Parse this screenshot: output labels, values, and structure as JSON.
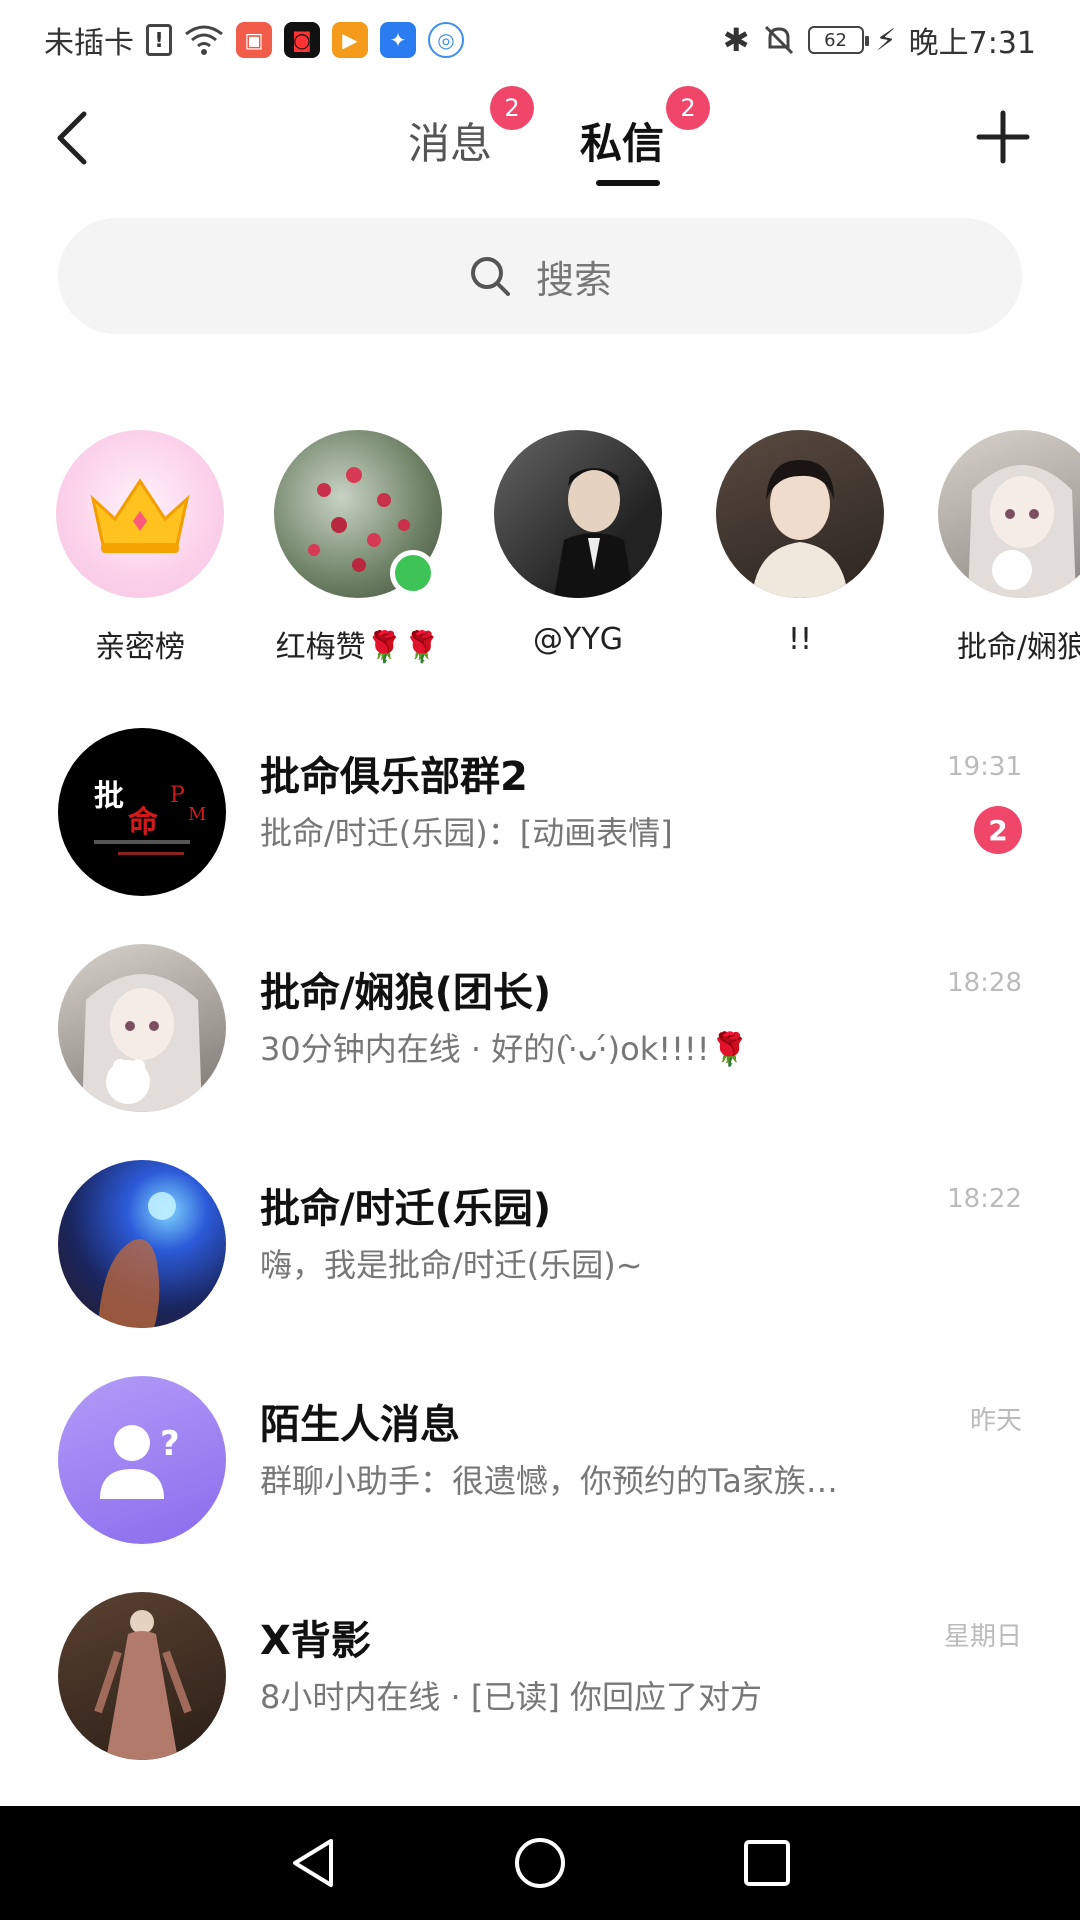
{
  "status_bar": {
    "carrier": "未插卡",
    "time": "晚上7:31",
    "battery": "62",
    "app_icons": [
      {
        "name": "kuaishou-app-icon",
        "color": "#f25c4b"
      },
      {
        "name": "video-app-icon",
        "color": "#111111"
      },
      {
        "name": "play-app-icon",
        "color": "#f59b1b"
      },
      {
        "name": "bulb-app-icon",
        "color": "#2a7cf0"
      },
      {
        "name": "browser-app-icon",
        "color": "#3c8ef0"
      }
    ]
  },
  "header": {
    "tabs": [
      {
        "label": "消息",
        "badge": "2"
      },
      {
        "label": "私信",
        "badge": "2",
        "active": true
      }
    ]
  },
  "search": {
    "placeholder": "搜索"
  },
  "stories": [
    {
      "name": "亲密榜",
      "avatar": "crown",
      "online": false
    },
    {
      "name": "红梅赞🌹🌹",
      "avatar": "plum-tree",
      "online": true
    },
    {
      "name": "@YYG",
      "avatar": "man-suit",
      "online": false
    },
    {
      "name": "!!",
      "avatar": "young-man",
      "online": false
    },
    {
      "name": "批命/娴狼",
      "avatar": "anime-girl",
      "online": false
    }
  ],
  "conversations": [
    {
      "name": "批命俱乐部群2",
      "preview": "批命/时迁(乐园)：[动画表情]",
      "time": "19:31",
      "badge": "2",
      "avatar": "group-logo"
    },
    {
      "name": "批命/娴狼(团长)",
      "preview": "30分钟内在线 · 好的(·̀ᴗ·́)ok!!!!🌹",
      "time": "18:28",
      "badge": "",
      "avatar": "anime-girl"
    },
    {
      "name": "批命/时迁(乐园)",
      "preview": "嗨，我是批命/时迁(乐园)~",
      "time": "18:22",
      "badge": "",
      "avatar": "blue-portrait"
    },
    {
      "name": "陌生人消息",
      "preview": "群聊小助手：很遗憾，你预约的Ta家族…",
      "time": "昨天",
      "badge": "",
      "avatar": "stranger"
    },
    {
      "name": "X背影",
      "preview": "8小时内在线 · [已读] 你回应了对方",
      "time": "星期日",
      "badge": "",
      "avatar": "costume-figure"
    }
  ],
  "colors": {
    "accent": "#f0466a",
    "online": "#3ec456",
    "stranger": "#9a7cf2"
  }
}
